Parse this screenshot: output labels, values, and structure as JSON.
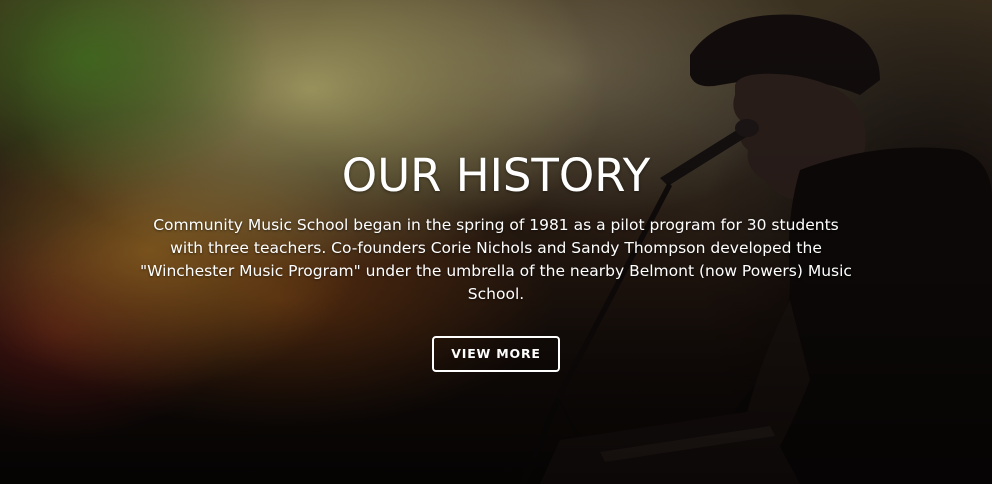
{
  "hero": {
    "title": "OUR HISTORY",
    "description": "Community Music School began in the spring of 1981 as a pilot program for 30 students with three teachers. Co-founders Corie Nichols and Sandy Thompson developed the \"Winchester Music Program\" under the umbrella of the nearby Belmont (now Powers) Music School.",
    "button_label": "VIEW MORE",
    "background_image": "performer-singing-into-microphone-photo"
  },
  "colors": {
    "text": "#ffffff",
    "button_border": "#ffffff",
    "background_dark": "#0d0908"
  }
}
